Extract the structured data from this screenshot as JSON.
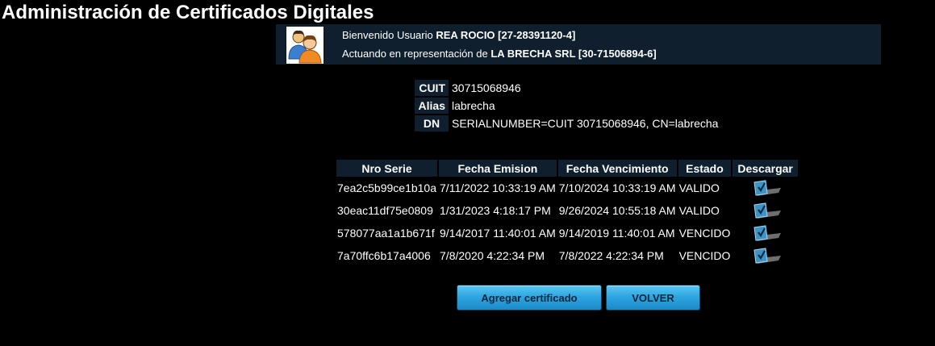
{
  "page": {
    "title": "Administración de Certificados Digitales"
  },
  "user": {
    "welcome_prefix": "Bienvenido Usuario",
    "user_name": "REA ROCIO [27-28391120-4]",
    "acting_prefix": "Actuando en representación de",
    "company": "LA BRECHA SRL [30-71506894-6]"
  },
  "certificate": {
    "cuit_label": "CUIT",
    "cuit_value": "30715068946",
    "alias_label": "Alias",
    "alias_value": "labrecha",
    "dn_label": "DN",
    "dn_value": "SERIALNUMBER=CUIT 30715068946, CN=labrecha"
  },
  "table": {
    "headers": {
      "serial": "Nro Serie",
      "issued": "Fecha Emision",
      "expires": "Fecha Vencimiento",
      "status": "Estado",
      "download": "Descargar"
    },
    "rows": [
      {
        "serial": "7ea2c5b99ce1b10a",
        "issued": "7/11/2022 10:33:19 AM",
        "expires": "7/10/2024 10:33:19 AM",
        "status": "VALIDO",
        "download_icon": "download-certificate-icon"
      },
      {
        "serial": "30eac11df75e0809",
        "issued": "1/31/2023 4:18:17 PM",
        "expires": "9/26/2024 10:55:18 AM",
        "status": "VALIDO",
        "download_icon": "download-certificate-icon"
      },
      {
        "serial": "578077aa1a1b671f",
        "issued": "9/14/2017 11:40:01 AM",
        "expires": "9/14/2019 11:40:01 AM",
        "status": "VENCIDO",
        "download_icon": "download-certificate-icon"
      },
      {
        "serial": "7a70ffc6b17a4006",
        "issued": "7/8/2020 4:22:34 PM",
        "expires": "7/8/2022 4:22:34 PM",
        "status": "VENCIDO",
        "download_icon": "download-certificate-icon"
      }
    ]
  },
  "actions": {
    "add_label": "Agregar certificado",
    "back_label": "VOLVER"
  },
  "colors": {
    "background": "#000000",
    "panel": "#0f1f2e",
    "button": "#2fa6e1",
    "button_text": "#0b2238"
  }
}
